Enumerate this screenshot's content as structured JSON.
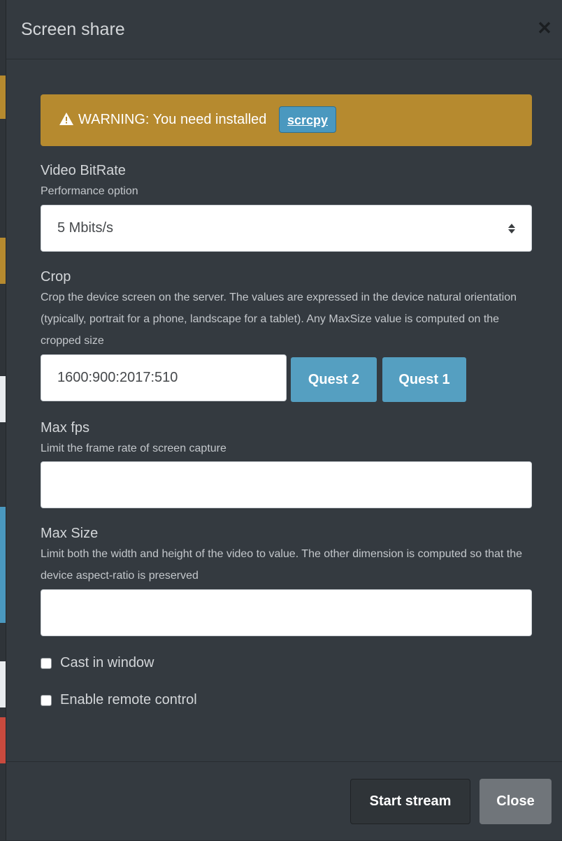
{
  "modal": {
    "title": "Screen share",
    "close_icon": "close-icon"
  },
  "warning": {
    "icon": "warning-triangle-icon",
    "text": "WARNING: You need installed",
    "link_label": "scrcpy",
    "color": "#b68a2f"
  },
  "bitrate": {
    "label": "Video BitRate",
    "help": "Performance option",
    "selected": "5 Mbits/s"
  },
  "crop": {
    "label": "Crop",
    "help": "Crop the device screen on the server. The values are expressed in the device natural orientation (typically, portrait for a phone, landscape for a tablet). Any MaxSize value is computed on the cropped size",
    "value": "1600:900:2017:510",
    "presets": [
      "Quest 2",
      "Quest 1"
    ]
  },
  "max_fps": {
    "label": "Max fps",
    "help": "Limit the frame rate of screen capture",
    "value": ""
  },
  "max_size": {
    "label": "Max Size",
    "help": "Limit both the width and height of the video to value. The other dimension is computed so that the device aspect-ratio is preserved",
    "value": ""
  },
  "options": {
    "cast_in_window": "Cast in window",
    "enable_remote_control": "Enable remote control"
  },
  "footer": {
    "start_label": "Start stream",
    "close_label": "Close"
  },
  "colors": {
    "modal_bg": "#343a40",
    "primary_button": "#559fc1",
    "secondary_button": "#70757a"
  }
}
